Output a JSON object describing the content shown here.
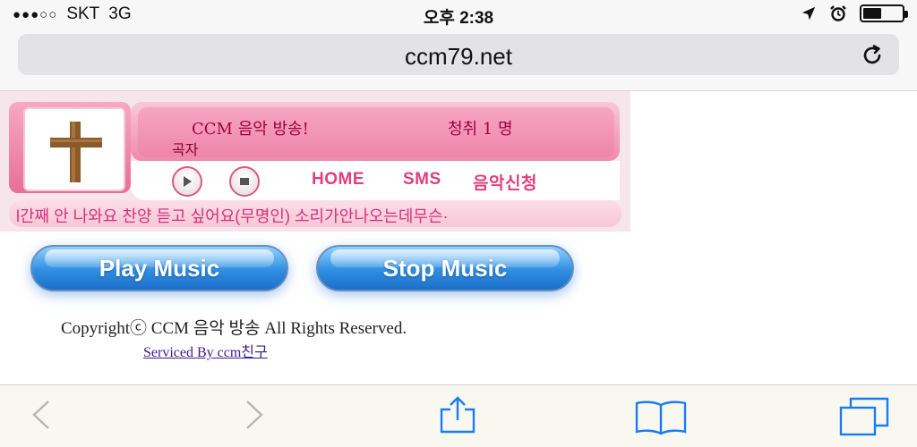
{
  "status_bar": {
    "carrier": "SKT",
    "network": "3G",
    "signal_dots": "●●●○○",
    "time": "오후 2:38"
  },
  "address_bar": {
    "url": "ccm79.net"
  },
  "player": {
    "broadcast_title": "CCM 음악 방송!",
    "listeners": "청취 1 명",
    "now_playing": "곡자",
    "menu": {
      "home": "HOME",
      "sms": "SMS",
      "request": "음악신청"
    },
    "marquee": "l간째 안 나와요 찬양 듣고 싶어요(무명인) 소리가안나오는데무슨·"
  },
  "buttons": {
    "play": "Play Music",
    "stop": "Stop Music"
  },
  "footer": {
    "copyright": "Copyrightⓒ CCM 음악 방송 All Rights Reserved.",
    "serviced_by": "Serviced By ccm친구"
  },
  "colors": {
    "accent_pink": "#e0407c",
    "button_blue": "#2f8fe2",
    "ios_blue": "#1a7cf5"
  }
}
